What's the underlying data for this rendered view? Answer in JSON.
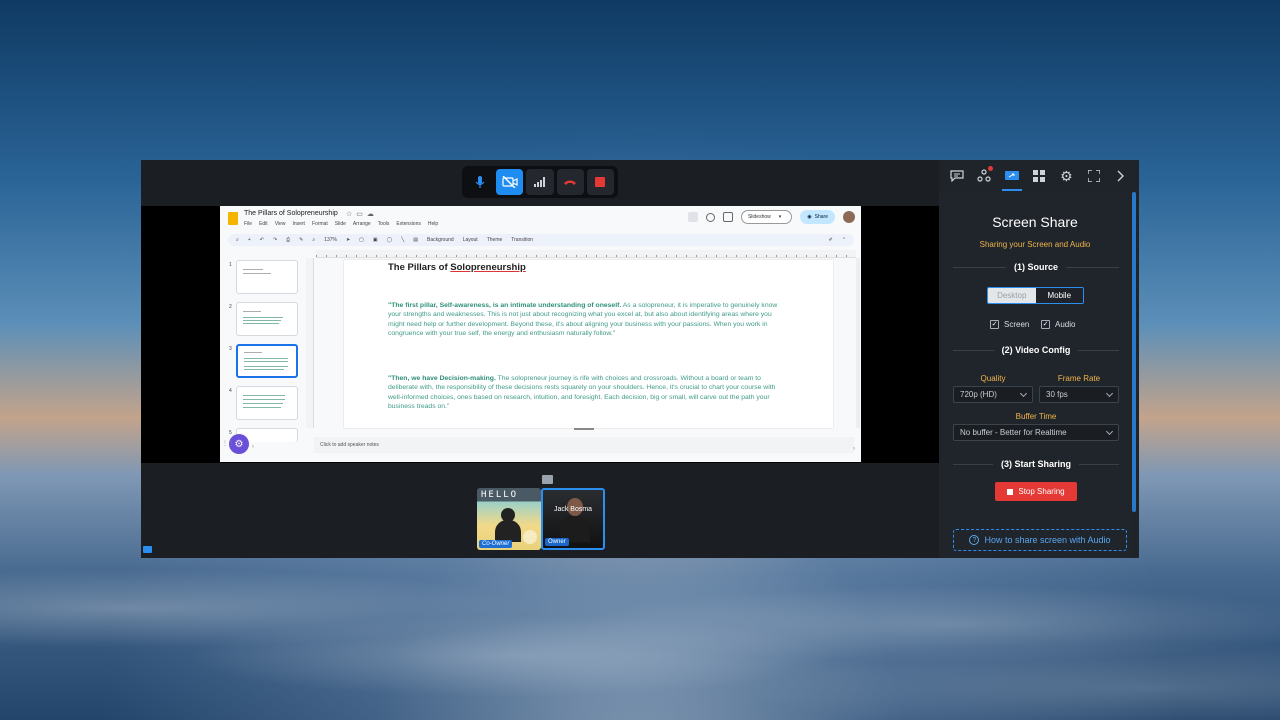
{
  "slides_app": {
    "doc_title": "The Pillars of Solopreneurship",
    "menu": [
      "File",
      "Edit",
      "View",
      "Insert",
      "Format",
      "Slide",
      "Arrange",
      "Tools",
      "Extensions",
      "Help"
    ],
    "slideshow_label": "Slideshow",
    "share_label": "Share",
    "zoom": "137%",
    "toolbar_items": [
      "Background",
      "Layout",
      "Theme",
      "Transition"
    ],
    "thumb_numbers": [
      "1",
      "2",
      "3",
      "4",
      "5"
    ],
    "slide": {
      "title_prefix": "The Pillars of ",
      "title_underlined": "Solopreneurship",
      "para1_bold": "\"The first pillar, Self-awareness, is an intimate understanding of oneself.",
      "para1_text": " As a solopreneur, it is imperative to genuinely know your strengths and weaknesses. This is not just about recognizing what you excel at, but also about identifying areas where you might need help or further development. Beyond these, it's about aligning your business with your passions. When you work in congruence with your true self, the energy and enthusiasm naturally follow.\"",
      "para2_bold": "\"Then, we have Decision-making.",
      "para2_text": " The solopreneur journey is rife with choices and crossroads. Without a board or team to deliberate with, the responsibility of these decisions rests squarely on your shoulders. Hence, it's crucial to chart your course with well-informed choices, ones based on research, intuition, and foresight. Each decision, big or small, will carve out the path your business treads on.\""
    },
    "notes_placeholder": "Click to add speaker notes"
  },
  "participants": [
    {
      "tile_text": "HELLO",
      "role": "Co-Owner"
    },
    {
      "name": "Jack Bosma",
      "role": "Owner"
    }
  ],
  "panel": {
    "title": "Screen Share",
    "subtitle": "Sharing your Screen and Audio",
    "section1": "(1) Source",
    "source_options": [
      "Desktop",
      "Mobile"
    ],
    "checkboxes": [
      "Screen",
      "Audio"
    ],
    "section2": "(2) Video Config",
    "quality_label": "Quality",
    "quality_value": "720p (HD)",
    "framerate_label": "Frame Rate",
    "framerate_value": "30 fps",
    "buffer_label": "Buffer Time",
    "buffer_value": "No buffer - Better for Realtime",
    "section3": "(3) Start Sharing",
    "stop_label": "Stop Sharing",
    "howto_label": "How to share screen with Audio"
  },
  "colors": {
    "accent": "#2c8ff0",
    "danger": "#e53935",
    "label_orange": "#f0b44a"
  }
}
